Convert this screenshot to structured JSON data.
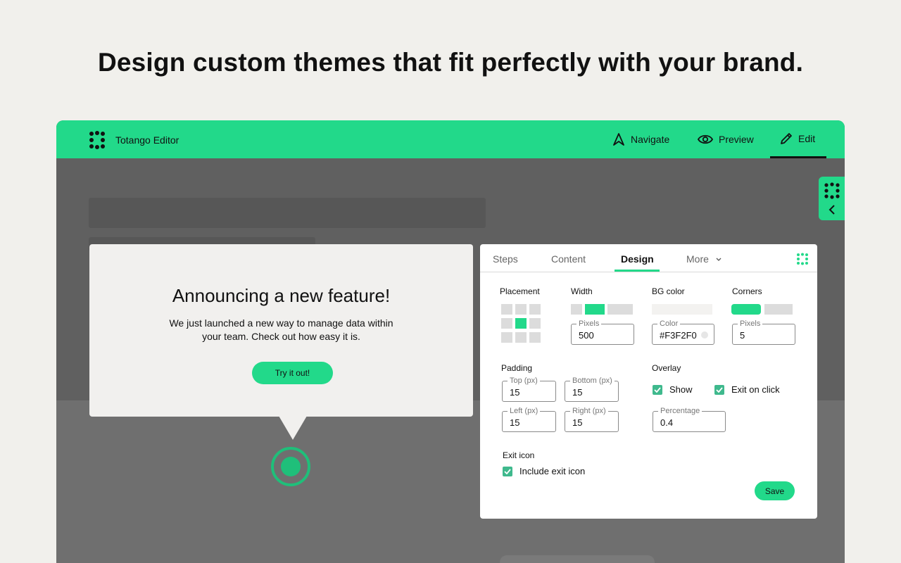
{
  "headline": "Design custom themes that fit perfectly with your brand.",
  "app": {
    "title": "Totango Editor",
    "nav": {
      "navigate": "Navigate",
      "preview": "Preview",
      "edit": "Edit"
    },
    "brand_color": "#22d98a"
  },
  "tooltip": {
    "title": "Announcing a new feature!",
    "body": "We just launched a new way to manage data within your team. Check out how easy it is.",
    "button": "Try it out!"
  },
  "panel": {
    "tabs": [
      {
        "label": "Steps"
      },
      {
        "label": "Content"
      },
      {
        "label": "Design"
      },
      {
        "label": "More"
      }
    ],
    "active_tab": "Design",
    "placement": {
      "label": "Placement",
      "selected": "center"
    },
    "width": {
      "label": "Width",
      "pixels_label": "Pixels",
      "pixels": "500"
    },
    "bg_color": {
      "label": "BG color",
      "color_label": "Color",
      "value": "#F3F2F0"
    },
    "corners": {
      "label": "Corners",
      "pixels_label": "Pixels",
      "pixels": "5"
    },
    "padding": {
      "label": "Padding",
      "top_label": "Top (px)",
      "top": "15",
      "bottom_label": "Bottom (px)",
      "bottom": "15",
      "left_label": "Left (px)",
      "left": "15",
      "right_label": "Right (px)",
      "right": "15"
    },
    "overlay": {
      "label": "Overlay",
      "show": "Show",
      "show_checked": true,
      "exit_on_click": "Exit on click",
      "exit_on_click_checked": true,
      "percentage_label": "Percentage",
      "percentage": "0.4"
    },
    "exit_icon": {
      "label": "Exit icon",
      "include": "Include exit icon",
      "include_checked": true
    },
    "save": "Save"
  }
}
